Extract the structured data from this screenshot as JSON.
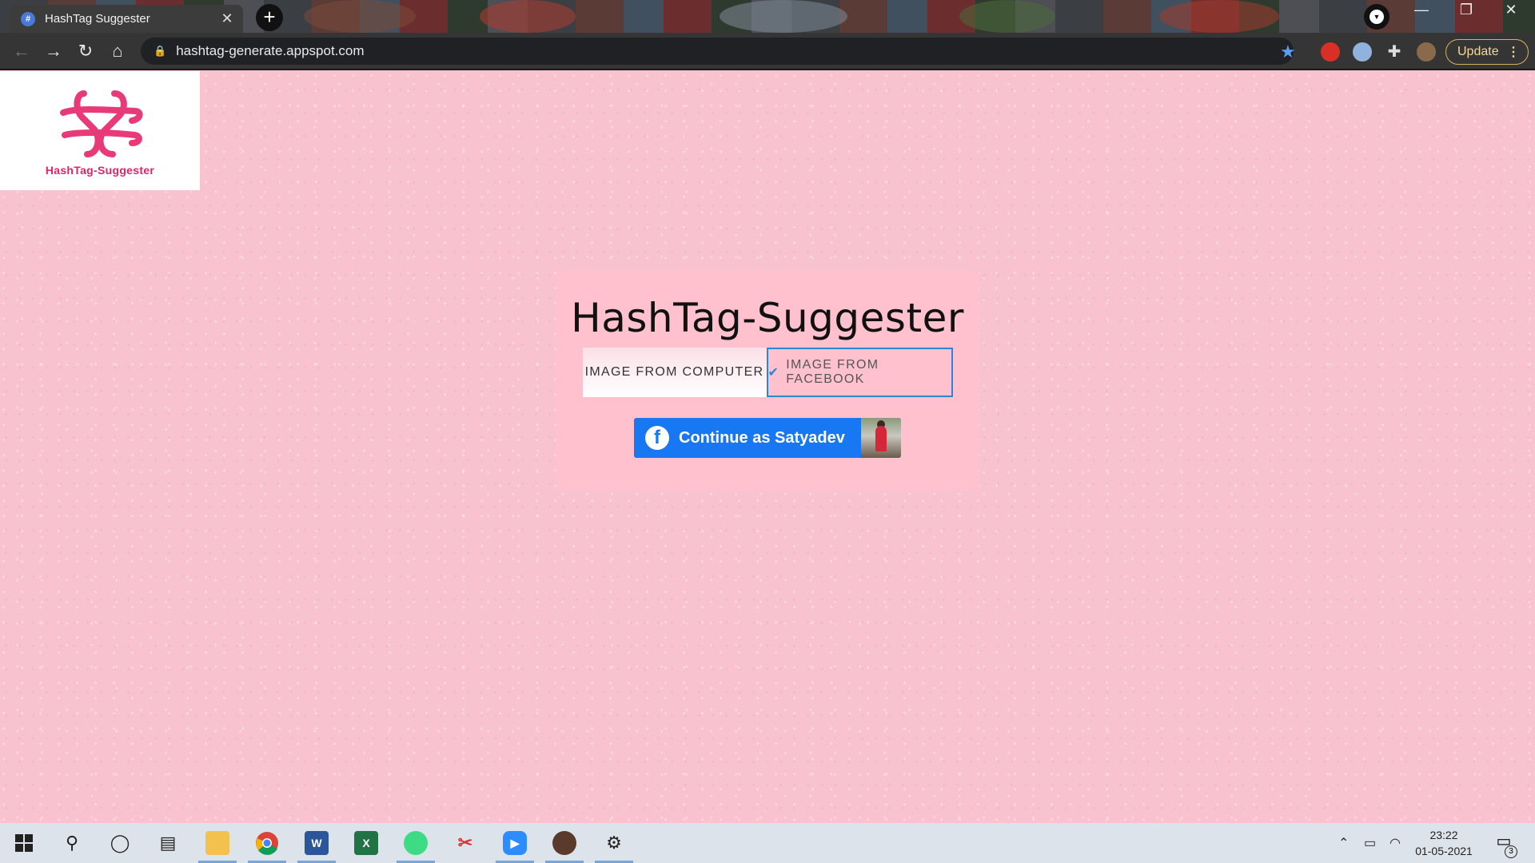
{
  "browser": {
    "tab_title": "HashTag Suggester",
    "tab_close": "✕",
    "new_tab": "+",
    "url": "hashtag-generate.appspot.com",
    "update_label": "Update",
    "update_menu": "⋮",
    "window_controls": {
      "minimize": "—",
      "restore": "❐",
      "close": "✕"
    },
    "nav": {
      "back": "←",
      "forward": "→",
      "reload": "↻",
      "home": "⌂"
    }
  },
  "page": {
    "logo_text": "HashTag-Suggester",
    "title": "HashTag-Suggester",
    "tabs": [
      {
        "label": "IMAGE FROM COMPUTER",
        "selected": false
      },
      {
        "label": "IMAGE FROM FACEBOOK",
        "selected": true
      }
    ],
    "facebook_button": {
      "logo": "f",
      "label": "Continue as Satyadev"
    },
    "colors": {
      "background": "#f8c3cf",
      "card": "#ffc1cd",
      "facebook_blue": "#1877f2",
      "selected_border": "#2b86d6",
      "logo_pink": "#e0236b"
    }
  },
  "taskbar": {
    "apps": [
      "windows-start",
      "search",
      "cortana",
      "task-view",
      "file-explorer",
      "chrome",
      "word",
      "excel",
      "android-studio",
      "snip-tool",
      "zoom",
      "game",
      "settings"
    ],
    "word_letter": "W",
    "excel_letter": "X",
    "time": "23:22",
    "date": "01-05-2021",
    "notification_count": "3"
  }
}
